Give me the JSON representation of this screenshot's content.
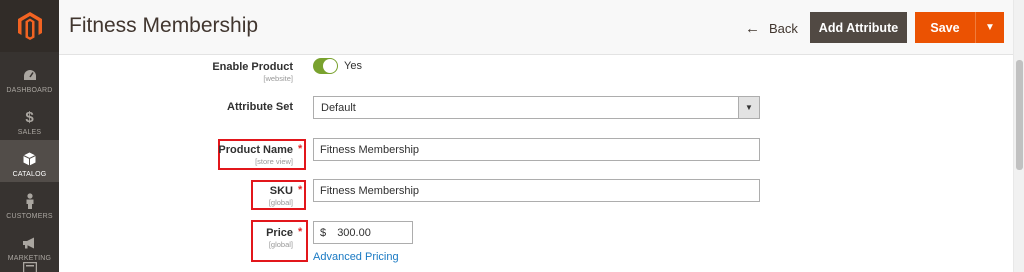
{
  "sidebar": {
    "logo_icon": "magento-logo",
    "items": [
      {
        "label": "DASHBOARD",
        "icon": "speedometer-icon"
      },
      {
        "label": "SALES",
        "icon": "dollar-icon"
      },
      {
        "label": "CATALOG",
        "icon": "cube-icon",
        "active": true
      },
      {
        "label": "CUSTOMERS",
        "icon": "person-icon"
      },
      {
        "label": "MARKETING",
        "icon": "megaphone-icon"
      },
      {
        "label": "",
        "icon": "content-icon"
      }
    ]
  },
  "header": {
    "title": "Fitness Membership",
    "back_label": "Back",
    "add_attribute_label": "Add Attribute",
    "save_label": "Save"
  },
  "form": {
    "enable_product": {
      "label": "Enable Product",
      "scope": "[website]",
      "value": "Yes",
      "checked": true
    },
    "attribute_set": {
      "label": "Attribute Set",
      "value": "Default"
    },
    "product_name": {
      "label": "Product Name",
      "scope": "[store view]",
      "value": "Fitness Membership",
      "required": true
    },
    "sku": {
      "label": "SKU",
      "scope": "[global]",
      "value": "Fitness Membership",
      "required": true
    },
    "price": {
      "label": "Price",
      "scope": "[global]",
      "currency": "$",
      "value": "300.00",
      "required": true,
      "advanced_link": "Advanced Pricing"
    }
  },
  "colors": {
    "accent": "#eb5202",
    "sidebar_bg": "#373330",
    "toggle_on": "#79a22e",
    "link": "#1979c3",
    "highlight_box": "#e2161b"
  }
}
